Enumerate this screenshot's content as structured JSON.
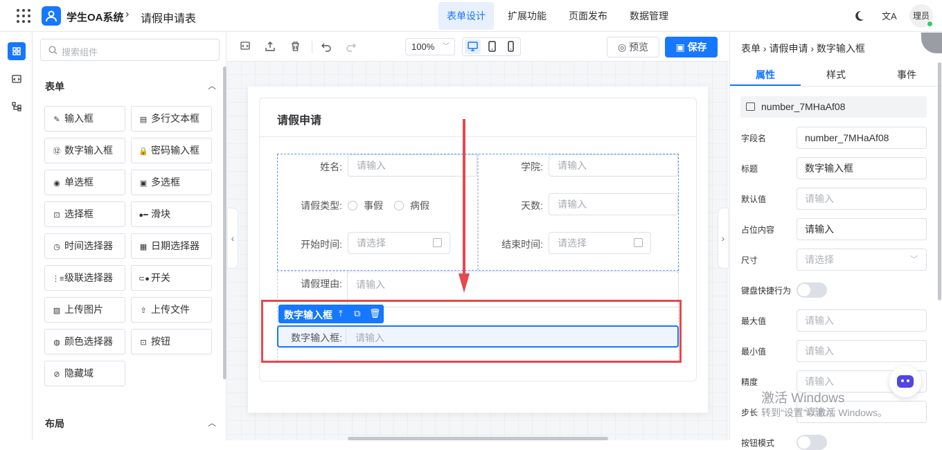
{
  "header": {
    "app_name": "学生OA系统",
    "separator": "›",
    "page_title": "请假申请表",
    "nav": [
      "表单设计",
      "扩展功能",
      "页面发布",
      "数据管理"
    ],
    "active_nav": "表单设计",
    "user": "理员"
  },
  "left": {
    "search_placeholder": "搜索组件",
    "section_form": "表单",
    "components": [
      {
        "label": "输入框",
        "icon": "edit-icon"
      },
      {
        "label": "多行文本框",
        "icon": "textarea-icon"
      },
      {
        "label": "数字输入框",
        "icon": "number-icon"
      },
      {
        "label": "密码输入框",
        "icon": "lock-icon"
      },
      {
        "label": "单选框",
        "icon": "radio-icon"
      },
      {
        "label": "多选框",
        "icon": "checkbox-icon"
      },
      {
        "label": "选择框",
        "icon": "select-icon"
      },
      {
        "label": "滑块",
        "icon": "slider-icon"
      },
      {
        "label": "时间选择器",
        "icon": "clock-icon"
      },
      {
        "label": "日期选择器",
        "icon": "calendar-icon"
      },
      {
        "label": "级联选择器",
        "icon": "cascader-icon"
      },
      {
        "label": "开关",
        "icon": "switch-icon"
      },
      {
        "label": "上传图片",
        "icon": "image-icon"
      },
      {
        "label": "上传文件",
        "icon": "upload-icon"
      },
      {
        "label": "颜色选择器",
        "icon": "palette-icon"
      },
      {
        "label": "按钮",
        "icon": "button-icon"
      },
      {
        "label": "隐藏域",
        "icon": "eye-off-icon"
      }
    ],
    "section_layout": "布局"
  },
  "toolbar": {
    "zoom": "100%",
    "preview": "预览",
    "save": "保存"
  },
  "form": {
    "title": "请假申请",
    "fields": {
      "name_label": "姓名:",
      "college_label": "学院:",
      "leave_type_label": "请假类型:",
      "leave_options": [
        "事假",
        "病假"
      ],
      "days_label": "天数:",
      "start_label": "开始时间:",
      "end_label": "结束时间:",
      "reason_label": "请假理由:",
      "input_placeholder": "请输入",
      "select_placeholder": "请选择"
    },
    "selected": {
      "tag": "数字输入框",
      "label": "数字输入框:",
      "placeholder": "请输入"
    }
  },
  "right": {
    "breadcrumb": [
      "表单",
      "请假申请",
      "数字输入框"
    ],
    "tabs": [
      "属性",
      "样式",
      "事件"
    ],
    "active_tab": "属性",
    "field_id": "number_7MHaAf08",
    "props": [
      {
        "label": "字段名",
        "value": "number_7MHaAf08",
        "placeholder": false,
        "type": "input"
      },
      {
        "label": "标题",
        "value": "数字输入框",
        "placeholder": false,
        "type": "input"
      },
      {
        "label": "默认值",
        "value": "请输入",
        "placeholder": true,
        "type": "input"
      },
      {
        "label": "占位内容",
        "value": "请输入",
        "placeholder": false,
        "type": "input"
      },
      {
        "label": "尺寸",
        "value": "请选择",
        "placeholder": true,
        "type": "select"
      },
      {
        "label": "键盘快捷行为",
        "value": "",
        "placeholder": false,
        "type": "toggle"
      },
      {
        "label": "最大值",
        "value": "请输入",
        "placeholder": true,
        "type": "input"
      },
      {
        "label": "最小值",
        "value": "请输入",
        "placeholder": true,
        "type": "input"
      },
      {
        "label": "精度",
        "value": "请输入",
        "placeholder": true,
        "type": "input"
      },
      {
        "label": "步长",
        "value": "请输入",
        "placeholder": true,
        "type": "input"
      },
      {
        "label": "按钮模式",
        "value": "",
        "placeholder": false,
        "type": "toggle"
      }
    ]
  },
  "watermark": {
    "line1": "激活 Windows",
    "line2": "转到“设置”以激活 Windows。"
  },
  "colors": {
    "accent": "#1677ff",
    "highlight": "#e5484d"
  }
}
